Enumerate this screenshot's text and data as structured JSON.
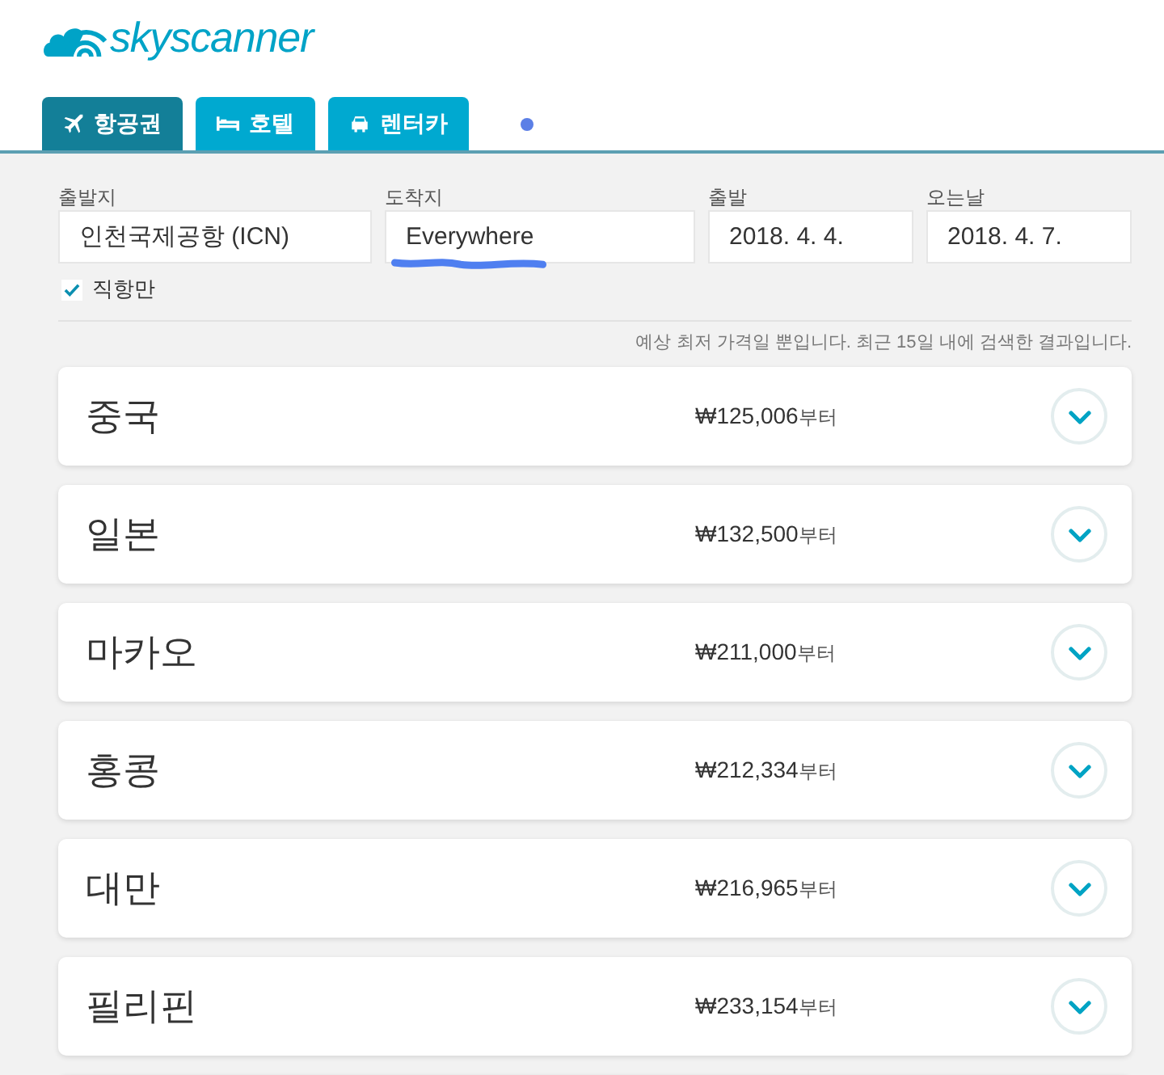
{
  "logo": {
    "text": "skyscanner"
  },
  "tabs": [
    {
      "label": "항공권",
      "kind": "plane",
      "selected": true
    },
    {
      "label": "호텔",
      "kind": "bed",
      "selected": false
    },
    {
      "label": "렌터카",
      "kind": "car",
      "selected": false
    }
  ],
  "search": {
    "fields": [
      {
        "label": "출발지",
        "value": "인천국제공항 (ICN)",
        "highlighted": false
      },
      {
        "label": "도착지",
        "value": "Everywhere",
        "highlighted": true
      },
      {
        "label": "출발",
        "value": "2018. 4. 4.",
        "highlighted": false
      },
      {
        "label": "오는날",
        "value": "2018. 4. 7.",
        "highlighted": false
      }
    ],
    "direct_only": {
      "label": "직항만",
      "checked": true
    },
    "note": "예상 최저 가격일 뿐입니다. 최근 15일 내에 검색한 결과입니다."
  },
  "results": [
    {
      "country": "중국",
      "price": "₩125,006",
      "suffix": "부터"
    },
    {
      "country": "일본",
      "price": "₩132,500",
      "suffix": "부터"
    },
    {
      "country": "마카오",
      "price": "₩211,000",
      "suffix": "부터"
    },
    {
      "country": "홍콩",
      "price": "₩212,334",
      "suffix": "부터"
    },
    {
      "country": "대만",
      "price": "₩216,965",
      "suffix": "부터"
    },
    {
      "country": "필리핀",
      "price": "₩233,154",
      "suffix": "부터"
    }
  ]
}
